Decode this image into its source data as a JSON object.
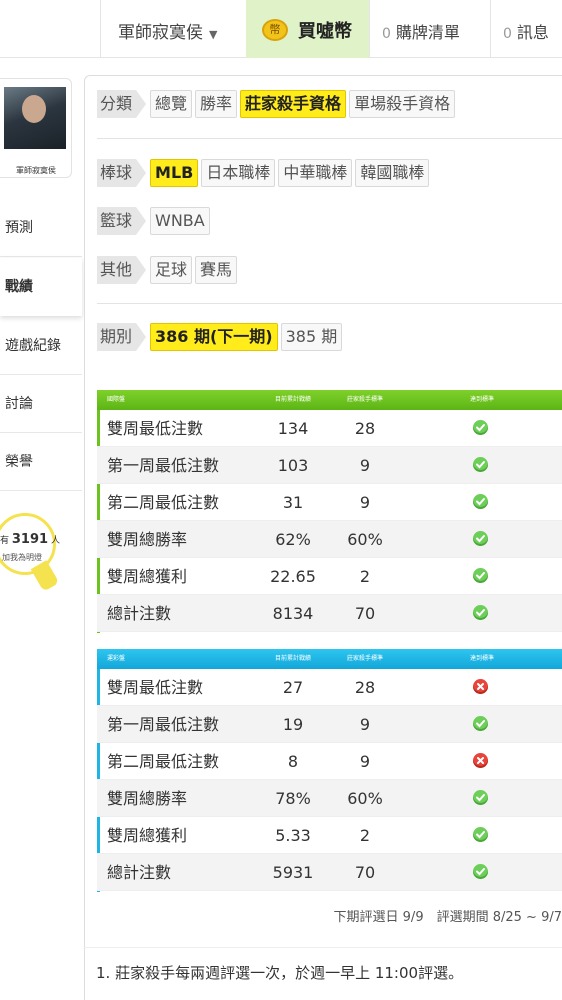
{
  "topbar": {
    "user_name": "軍師寂寞侯",
    "coin_icon_text": "幣",
    "coin_label": "買噓幣",
    "cart_count": "0",
    "cart_label": "購牌清單",
    "msg_count": "0",
    "msg_label": "訊息"
  },
  "sidebar": {
    "avatar_name": "軍師寂寞侯",
    "items": [
      {
        "label": "預測"
      },
      {
        "label": "戰績"
      },
      {
        "label": "遊戲紀錄"
      },
      {
        "label": "討論"
      },
      {
        "label": "榮譽"
      }
    ],
    "fans_prefix": "有",
    "fans_count": "3191",
    "fans_suffix": "人",
    "fans_text": "加我為明燈"
  },
  "filters": {
    "category": {
      "label": "分類",
      "options": [
        "總覽",
        "勝率",
        "莊家殺手資格",
        "單場殺手資格"
      ],
      "active": "莊家殺手資格"
    },
    "baseball": {
      "label": "棒球",
      "options": [
        "MLB",
        "日本職棒",
        "中華職棒",
        "韓國職棒"
      ],
      "active": "MLB"
    },
    "basketball": {
      "label": "籃球",
      "options": [
        "WNBA"
      ]
    },
    "other": {
      "label": "其他",
      "options": [
        "足球",
        "賽馬"
      ]
    },
    "period": {
      "label": "期別",
      "options": [
        "386 期(下一期)",
        "385 期"
      ],
      "active": "386 期(下一期)"
    }
  },
  "table_international": {
    "headers": [
      "國際盤",
      "目前累計戰績",
      "莊家殺手標準",
      "達到標準"
    ],
    "rows": [
      {
        "name": "雙周最低注數",
        "current": "134",
        "standard": "28",
        "met": true
      },
      {
        "name": "第一周最低注數",
        "current": "103",
        "standard": "9",
        "met": true
      },
      {
        "name": "第二周最低注數",
        "current": "31",
        "standard": "9",
        "met": true
      },
      {
        "name": "雙周總勝率",
        "current": "62%",
        "standard": "60%",
        "met": true
      },
      {
        "name": "雙周總獲利",
        "current": "22.65",
        "standard": "2",
        "met": true
      },
      {
        "name": "總計注數",
        "current": "8134",
        "standard": "70",
        "met": true
      }
    ]
  },
  "table_lottery": {
    "headers": [
      "運彩盤",
      "目前累計戰績",
      "莊家殺手標準",
      "達到標準"
    ],
    "rows": [
      {
        "name": "雙周最低注數",
        "current": "27",
        "standard": "28",
        "met": false
      },
      {
        "name": "第一周最低注數",
        "current": "19",
        "standard": "9",
        "met": true
      },
      {
        "name": "第二周最低注數",
        "current": "8",
        "standard": "9",
        "met": false
      },
      {
        "name": "雙周總勝率",
        "current": "78%",
        "standard": "60%",
        "met": true
      },
      {
        "name": "雙周總獲利",
        "current": "5.33",
        "standard": "2",
        "met": true
      },
      {
        "name": "總計注數",
        "current": "5931",
        "standard": "70",
        "met": true
      }
    ]
  },
  "footnote": "下期評選日 9/9　評選期間 8/25 ~ 9/7",
  "note": "1.  莊家殺手每兩週評選一次，於週一早上 11:00評選。",
  "colors": {
    "active_chip": "#ffec1a",
    "green_header": "#6cc21e",
    "blue_header": "#1fb4e4",
    "ok": "#6dcf59",
    "fail": "#e8443a"
  }
}
